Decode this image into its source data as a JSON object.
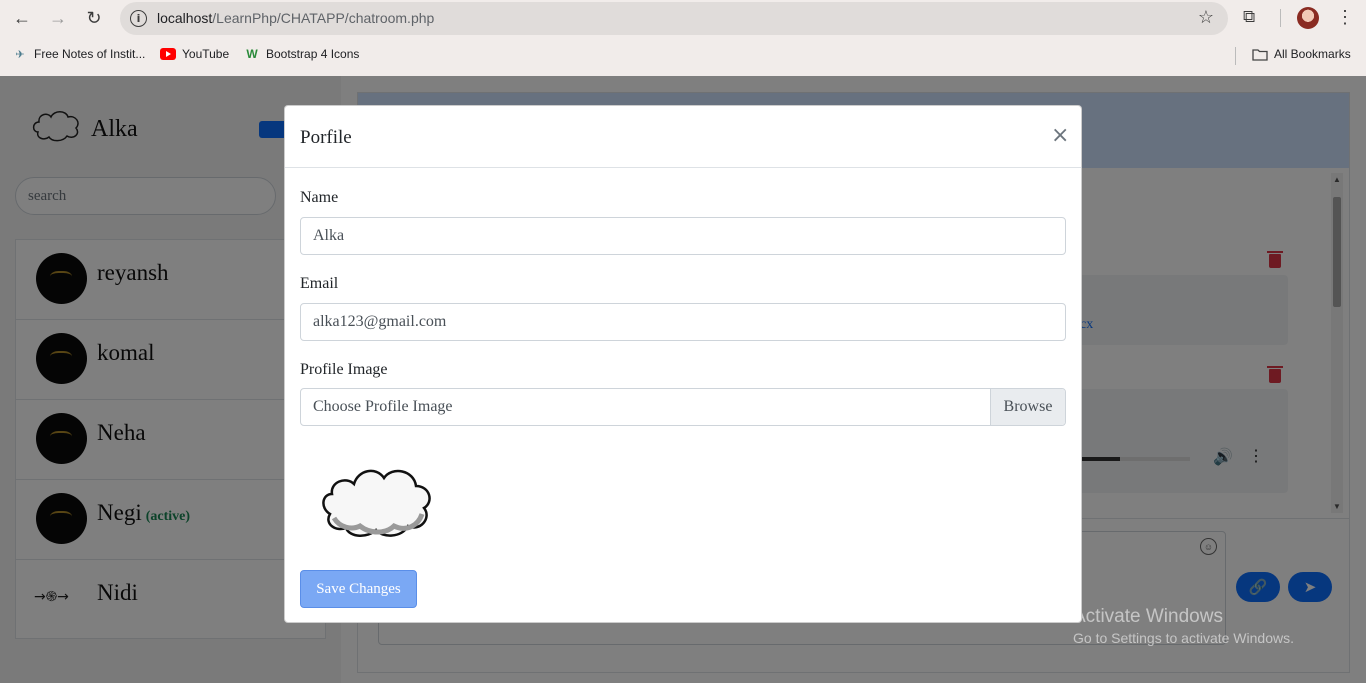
{
  "browser": {
    "url_host": "localhost",
    "url_path": "/LearnPhp/CHATAPP/chatroom.php",
    "bookmarks": [
      {
        "label": "Free Notes of Instit...",
        "icon": "bird-icon"
      },
      {
        "label": "YouTube",
        "icon": "youtube-icon"
      },
      {
        "label": "Bootstrap 4 Icons",
        "icon": "w-icon"
      }
    ],
    "all_bookmarks": "All Bookmarks"
  },
  "sidebar": {
    "me_name": "Alka",
    "search_placeholder": "search",
    "users": [
      {
        "name": "reyansh",
        "status": ""
      },
      {
        "name": "komal",
        "status": ""
      },
      {
        "name": "Neha",
        "status": ""
      },
      {
        "name": "Negi",
        "status": "(active)"
      },
      {
        "name": "Nidi",
        "status": "",
        "avatar_text": "→֍→"
      }
    ]
  },
  "chat": {
    "link_fragment": "cx"
  },
  "modal": {
    "title": "Porfile",
    "close_symbol": "×",
    "name_label": "Name",
    "name_value": "Alka",
    "email_label": "Email",
    "email_value": "alka123@gmail.com",
    "image_label": "Profile Image",
    "image_placeholder": "Choose Profile Image",
    "browse_label": "Browse",
    "save_label": "Save Changes"
  },
  "watermark": {
    "title": "Activate Windows",
    "subtitle": "Go to Settings to activate Windows."
  }
}
